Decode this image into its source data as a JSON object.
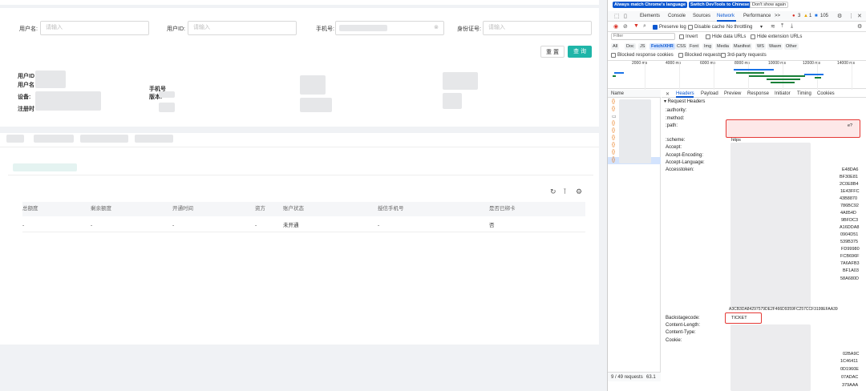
{
  "search": {
    "username_label": "用户名:",
    "username_placeholder": "请输入",
    "userid_label": "用户ID:",
    "userid_placeholder": "请输入",
    "phone_label": "手机号:",
    "idcard_label": "身份证号:",
    "idcard_placeholder": "请输入",
    "reset_label": "重 置",
    "query_label": "查 询"
  },
  "info": {
    "userid_label": "用户ID",
    "username_label": "用户名",
    "device_label": "设备:",
    "register_label": "注册时",
    "phone_label": "手机号",
    "version_label": "版本:"
  },
  "table": {
    "headers": [
      "总额度",
      "剩余额度",
      "开通时间",
      "资方",
      "账户状态",
      "授信手机号",
      "是否已绑卡"
    ],
    "rows": [
      [
        "-",
        "-",
        "-",
        "-",
        "未开通",
        "-",
        "否"
      ]
    ]
  },
  "devtools": {
    "banner": {
      "btn1": "Always match Chrome's language",
      "btn2": "Switch DevTools to Chinese",
      "btn3": "Don't show again"
    },
    "tabs": [
      "Elements",
      "Console",
      "Sources",
      "Network",
      "Performance",
      ">>"
    ],
    "active_tab": "Network",
    "counts": {
      "errors": "3",
      "warnings": "1",
      "messages": "105"
    },
    "toolbar": {
      "preserve_log": "Preserve log",
      "disable_cache": "Disable cache",
      "throttling": "No throttling"
    },
    "filter_placeholder": "Filter",
    "filter_opts": [
      "Invert",
      "Hide data URLs",
      "Hide extension URLs"
    ],
    "type_filters": [
      "All",
      "Doc",
      "JS",
      "Fetch/XHR",
      "CSS",
      "Font",
      "Img",
      "Media",
      "Manifest",
      "WS",
      "Wasm",
      "Other"
    ],
    "active_type": "Fetch/XHR",
    "blocked_opts": [
      "Blocked response cookies",
      "Blocked requests",
      "3rd-party requests"
    ],
    "timeline_ticks": [
      "2000 ms",
      "4000 ms",
      "6000 ms",
      "8000 ms",
      "10000 ms",
      "12000 ms",
      "14000 ms"
    ],
    "name_header": "Name",
    "detail_tabs": [
      "Headers",
      "Payload",
      "Preview",
      "Response",
      "Initiator",
      "Timing",
      "Cookies"
    ],
    "active_detail_tab": "Headers",
    "section_title": "▾ Request Headers",
    "headers": [
      {
        "name": ":authority:",
        "value": ""
      },
      {
        "name": ":method:",
        "value": ""
      },
      {
        "name": ":path:",
        "value": "e?"
      },
      {
        "name": ":scheme:",
        "value": "https"
      },
      {
        "name": "Accept:",
        "value": ""
      },
      {
        "name": "Accept-Encoding:",
        "value": ""
      },
      {
        "name": "Accept-Language:",
        "value": ""
      },
      {
        "name": "Accesstoken:",
        "value": ""
      },
      {
        "name": "Backstagecode:",
        "value": "TICKET"
      },
      {
        "name": "Content-Length:",
        "value": ""
      },
      {
        "name": "Content-Type:",
        "value": ""
      },
      {
        "name": "Cookie:",
        "value": ""
      }
    ],
    "token_tail": [
      "E48DA6",
      "BF30E81",
      "2C0E8B4",
      "1E43FFC",
      "43B8870",
      "786BC92",
      "4A854D",
      "9BFDC3",
      "A16DDA8",
      "0904D51",
      "539B375",
      "FD99980",
      "FCB696F",
      "7A6AFB3",
      "BF1A03",
      "58A680D"
    ],
    "token_last": "A3CB3DA84297579DE2F466D9359FC257CCF3199EFAA39",
    "cookie_tail": [
      "02BA9C",
      "1C46411",
      "0D1960E",
      "07ADAC",
      "379AAA"
    ],
    "status_requests": "9 / 49 requests",
    "status_size": "63.1"
  }
}
